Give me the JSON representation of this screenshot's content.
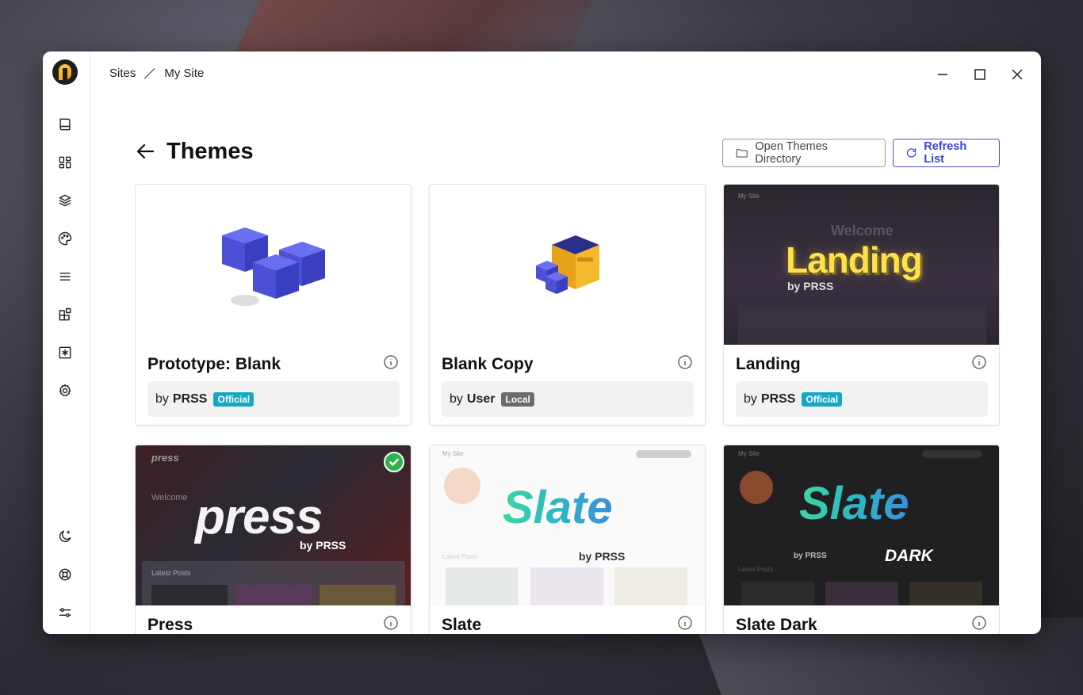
{
  "breadcrumb": {
    "root": "Sites",
    "current": "My Site"
  },
  "page": {
    "title": "Themes"
  },
  "actions": {
    "open_dir_label": "Open Themes Directory",
    "refresh_label": "Refresh List"
  },
  "sidebar": {
    "items": [
      {
        "name": "posts",
        "icon": "book-icon"
      },
      {
        "name": "dashboard",
        "icon": "grid-icon"
      },
      {
        "name": "layers",
        "icon": "layers-icon"
      },
      {
        "name": "themes",
        "icon": "palette-icon"
      },
      {
        "name": "menus",
        "icon": "menu-icon"
      },
      {
        "name": "plugins",
        "icon": "blocks-icon"
      },
      {
        "name": "snippets",
        "icon": "asterisk-icon"
      },
      {
        "name": "settings",
        "icon": "gear-icon"
      }
    ],
    "bottom": [
      {
        "name": "dark-mode",
        "icon": "moon-icon"
      },
      {
        "name": "help",
        "icon": "lifebuoy-icon"
      },
      {
        "name": "preferences",
        "icon": "sliders-icon"
      }
    ]
  },
  "themes": [
    {
      "title": "Prototype: Blank",
      "by": "by",
      "author": "PRSS",
      "badge": "Official",
      "badge_type": "official"
    },
    {
      "title": "Blank Copy",
      "by": "by",
      "author": "User",
      "badge": "Local",
      "badge_type": "local"
    },
    {
      "title": "Landing",
      "by": "by",
      "author": "PRSS",
      "badge": "Official",
      "badge_type": "official"
    },
    {
      "title": "Press",
      "active": true
    },
    {
      "title": "Slate"
    },
    {
      "title": "Slate Dark"
    }
  ],
  "thumbs": {
    "landing": {
      "site": "My Site",
      "welcome": "Welcome",
      "word": "Landing",
      "by": "by PRSS"
    },
    "press": {
      "site": "press",
      "welcome": "Welcome",
      "word": "press",
      "by": "by PRSS",
      "latest": "Latest Posts"
    },
    "slate": {
      "site": "My Site",
      "word": "Slate",
      "by": "by PRSS",
      "latest": "Latest Posts"
    },
    "slate_dark": {
      "site": "My Site",
      "word": "Slate",
      "by": "by PRSS",
      "dark": "DARK",
      "latest": "Latest Posts"
    }
  },
  "colors": {
    "accent": "#3b42d1",
    "official": "#15a8c4",
    "local": "#6b6b6b",
    "active": "#2eb24b"
  }
}
